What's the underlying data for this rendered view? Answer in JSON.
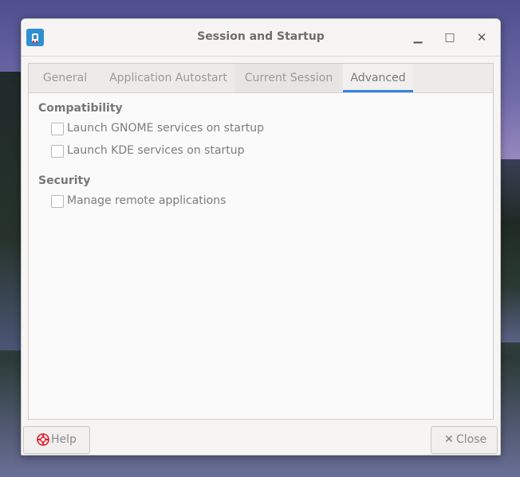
{
  "window": {
    "title": "Session and Startup",
    "controls": {
      "minimize": "▁",
      "maximize": "□",
      "close": "✕"
    }
  },
  "tabs": [
    {
      "label": "General"
    },
    {
      "label": "Application Autostart"
    },
    {
      "label": "Current Session"
    },
    {
      "label": "Advanced"
    }
  ],
  "active_tab": "Advanced",
  "advanced": {
    "compatibility": {
      "title": "Compatibility",
      "options": [
        {
          "label": "Launch GNOME services on startup",
          "checked": false
        },
        {
          "label": "Launch KDE services on startup",
          "checked": false
        }
      ]
    },
    "security": {
      "title": "Security",
      "options": [
        {
          "label": "Manage remote applications",
          "checked": false
        }
      ]
    }
  },
  "footer": {
    "help_label": "Help",
    "close_label": "Close",
    "close_glyph": "✕"
  },
  "colors": {
    "accent": "#3584e4",
    "app_icon": "#2f8fd0",
    "help_icon": "#e01b24"
  },
  "icons": {
    "app": "session-startup-icon",
    "help": "help-lifebuoy-icon",
    "close": "close-icon"
  }
}
